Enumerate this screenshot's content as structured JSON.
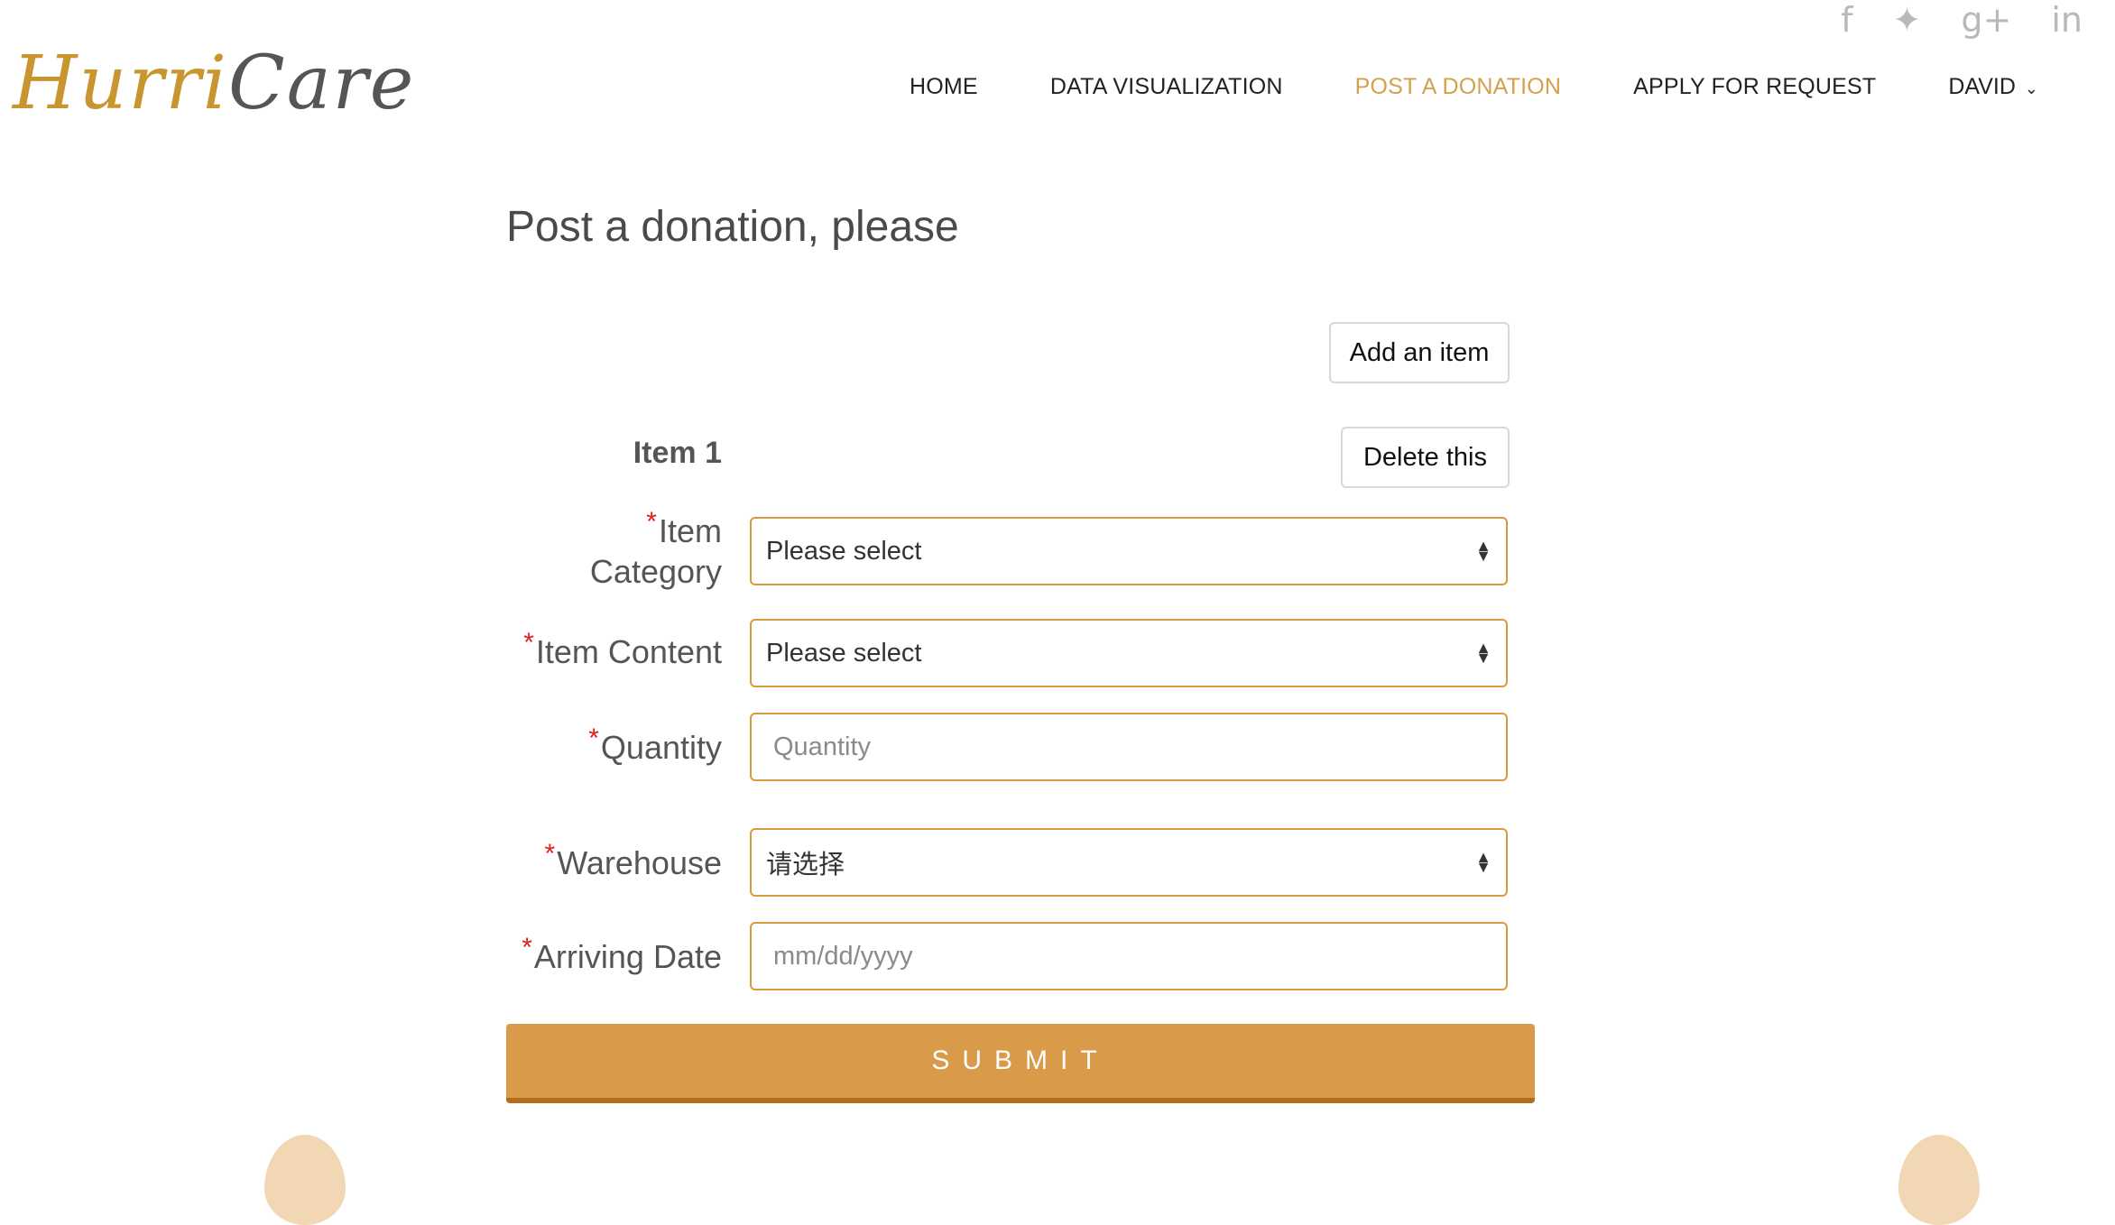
{
  "logo": {
    "part1": "Hurri",
    "part2": "Care"
  },
  "social": [
    {
      "name": "facebook-icon",
      "glyph": "f"
    },
    {
      "name": "twitter-icon",
      "glyph": "🐦"
    },
    {
      "name": "google-plus-icon",
      "glyph": "g+"
    },
    {
      "name": "linkedin-icon",
      "glyph": "in"
    }
  ],
  "nav": {
    "home": "HOME",
    "data_visualization": "DATA VISUALIZATION",
    "post_donation": "POST A DONATION",
    "apply_request": "APPLY FOR REQUEST",
    "user": "DAVID"
  },
  "page": {
    "title": "Post a donation, please"
  },
  "buttons": {
    "add_item": "Add an item",
    "delete_item": "Delete this",
    "submit": "SUBMIT"
  },
  "item": {
    "title": "Item 1",
    "category": {
      "label_line1": "Item",
      "label_line2": "Category",
      "value": "Please select"
    },
    "content": {
      "label": "Item Content",
      "value": "Please select"
    },
    "quantity": {
      "label": "Quantity",
      "placeholder": "Quantity"
    },
    "warehouse": {
      "label": "Warehouse",
      "value": "请选择"
    },
    "arriving_date": {
      "label": "Arriving Date",
      "placeholder": "mm/dd/yyyy"
    }
  },
  "required_mark": "*",
  "colors": {
    "accent": "#d69a3c",
    "active_nav": "#d4a14b",
    "submit_bg": "#d99a4a",
    "required": "#e02020"
  }
}
